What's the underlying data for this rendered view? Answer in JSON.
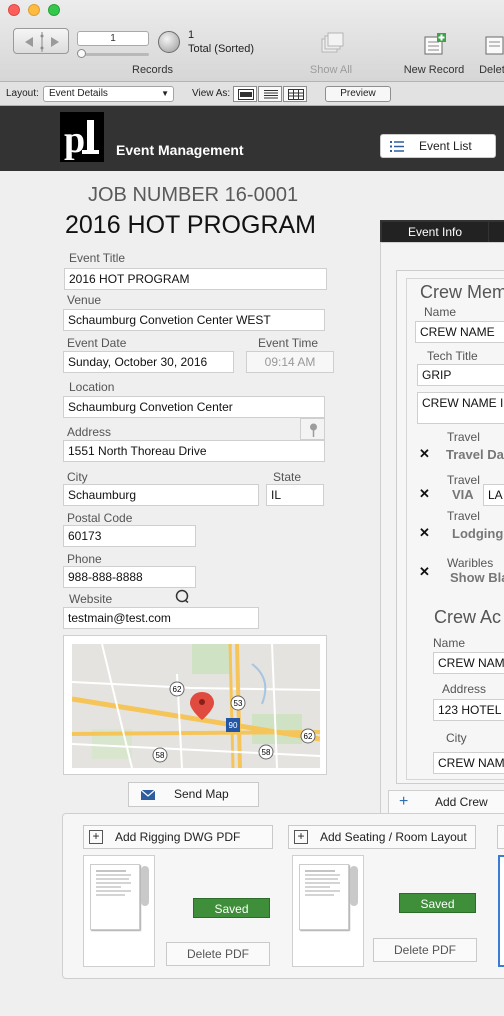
{
  "toolbar": {
    "record_number": "1",
    "record_count": "1",
    "record_total": "Total (Sorted)",
    "records_label": "Records",
    "show_all_label": "Show All",
    "new_record_label": "New Record",
    "delete_record_label": "Delete"
  },
  "layout_bar": {
    "layout_label": "Layout:",
    "layout_value": "Event Details",
    "view_as_label": "View As:",
    "preview_label": "Preview"
  },
  "header": {
    "logo_text": "pl",
    "app_title": "Event Management",
    "event_list_label": "Event List"
  },
  "event": {
    "job_number": "JOB NUMBER 16-0001",
    "program_title": "2016 HOT PROGRAM",
    "fields": {
      "event_title_label": "Event Title",
      "event_title": "2016 HOT PROGRAM",
      "venue_label": "Venue",
      "venue": "Schaumburg Convetion Center WEST",
      "event_date_label": "Event Date",
      "event_date": "Sunday, October 30, 2016",
      "event_time_label": "Event Time",
      "event_time": "09:14 AM",
      "location_label": "Location",
      "location": "Schaumburg Convetion Center",
      "address_label": "Address",
      "address": "1551 North Thoreau Drive",
      "city_label": "City",
      "city": "Schaumburg",
      "state_label": "State",
      "state": "IL",
      "postal_label": "Postal Code",
      "postal": "60173",
      "phone_label": "Phone",
      "phone": "988-888-8888",
      "website_label": "Website",
      "website": "testmain@test.com"
    },
    "map": {
      "road_labels": [
        "62",
        "53",
        "90",
        "62",
        "58",
        "58"
      ]
    },
    "send_map_label": "Send Map"
  },
  "tabs": {
    "active": "Event Info"
  },
  "crew": {
    "member_title": "Crew Mem",
    "name_label": "Name",
    "name_value": "CREW NAME",
    "tech_title_label": "Tech Title",
    "tech_title_value": "GRIP",
    "notes_value": "CREW NAME I",
    "travel_label_1": "Travel",
    "travel_dates": "Travel Da",
    "travel_label_2": "Travel",
    "via_label": "VIA",
    "via_value": "LA",
    "travel_label_3": "Travel",
    "lodging": "Lodging",
    "waribles_label": "Waribles",
    "show_blank": "Show Bla",
    "check_mark": "✕",
    "address_title": "Crew Ac",
    "addr_name_label": "Name",
    "addr_name_value": "CREW NAM",
    "addr_address_label": "Address",
    "addr_address_value": "123 HOTEL",
    "addr_city_label": "City",
    "addr_city_value": "CREW NAM",
    "add_crew_label": "Add Crew"
  },
  "attachments": {
    "add_rigging_label": "Add Rigging DWG PDF",
    "add_seating_label": "Add Seating / Room Layout",
    "saved_label": "Saved",
    "delete_pdf_label": "Delete PDF"
  }
}
